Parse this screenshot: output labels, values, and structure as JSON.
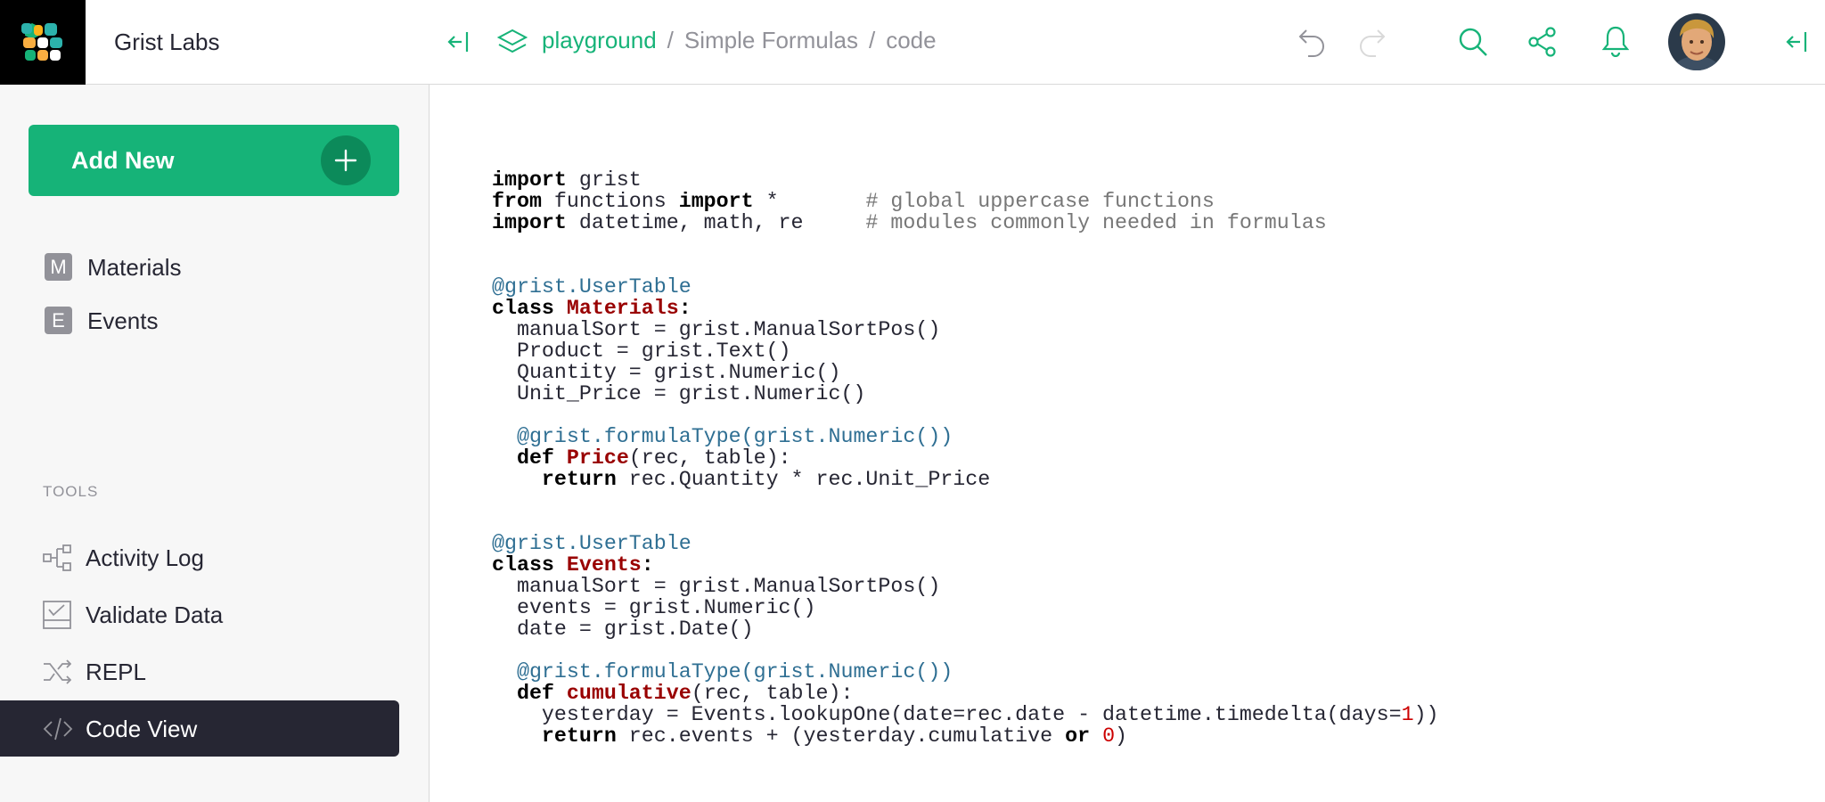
{
  "org": {
    "name": "Grist Labs"
  },
  "left_panel": {
    "add_new_label": "Add New",
    "pages": [
      {
        "initial": "M",
        "label": "Materials"
      },
      {
        "initial": "E",
        "label": "Events"
      }
    ],
    "tools_header": "TOOLS",
    "tools": [
      {
        "label": "Activity Log",
        "icon": "activity-log-icon"
      },
      {
        "label": "Validate Data",
        "icon": "validate-data-icon"
      },
      {
        "label": "REPL",
        "icon": "repl-icon"
      },
      {
        "label": "Code View",
        "icon": "code-view-icon",
        "active": true
      }
    ]
  },
  "topbar": {
    "breadcrumb": {
      "workspace": "playground",
      "separator": "/",
      "document": "Simple Formulas",
      "page": "code"
    },
    "icons": [
      "collapse-panel-icon",
      "workspace-icon",
      "undo-icon",
      "redo-icon",
      "search-icon",
      "share-icon",
      "notifications-icon",
      "avatar",
      "collapse-right-panel-icon"
    ]
  },
  "colors": {
    "accent": "#16b378",
    "active_tool_bg": "#262633",
    "logo_bg": "#000000"
  },
  "code_lines": [
    [
      {
        "t": "import",
        "c": "kw"
      },
      {
        "t": " grist",
        "c": ""
      }
    ],
    [
      {
        "t": "from",
        "c": "kw"
      },
      {
        "t": " functions ",
        "c": ""
      },
      {
        "t": "import",
        "c": "kw"
      },
      {
        "t": " *       ",
        "c": ""
      },
      {
        "t": "# global uppercase functions",
        "c": "cm"
      }
    ],
    [
      {
        "t": "import",
        "c": "kw"
      },
      {
        "t": " datetime, math, re     ",
        "c": ""
      },
      {
        "t": "# modules commonly needed in formulas",
        "c": "cm"
      }
    ],
    [],
    [],
    [
      {
        "t": "@grist.UserTable",
        "c": "dec"
      }
    ],
    [
      {
        "t": "class",
        "c": "kw"
      },
      {
        "t": " ",
        "c": ""
      },
      {
        "t": "Materials",
        "c": "nm"
      },
      {
        "t": ":",
        "c": "kw"
      }
    ],
    [
      {
        "t": "  manualSort = grist.ManualSortPos()",
        "c": ""
      }
    ],
    [
      {
        "t": "  Product = grist.Text()",
        "c": ""
      }
    ],
    [
      {
        "t": "  Quantity = grist.Numeric()",
        "c": ""
      }
    ],
    [
      {
        "t": "  Unit_Price = grist.Numeric()",
        "c": ""
      }
    ],
    [],
    [
      {
        "t": "  ",
        "c": ""
      },
      {
        "t": "@grist.formulaType(grist.Numeric())",
        "c": "dec"
      }
    ],
    [
      {
        "t": "  ",
        "c": ""
      },
      {
        "t": "def",
        "c": "kw"
      },
      {
        "t": " ",
        "c": ""
      },
      {
        "t": "Price",
        "c": "nm"
      },
      {
        "t": "(rec, table):",
        "c": ""
      }
    ],
    [
      {
        "t": "    ",
        "c": ""
      },
      {
        "t": "return",
        "c": "kw"
      },
      {
        "t": " rec.Quantity * rec.Unit_Price",
        "c": ""
      }
    ],
    [],
    [],
    [
      {
        "t": "@grist.UserTable",
        "c": "dec"
      }
    ],
    [
      {
        "t": "class",
        "c": "kw"
      },
      {
        "t": " ",
        "c": ""
      },
      {
        "t": "Events",
        "c": "nm"
      },
      {
        "t": ":",
        "c": "kw"
      }
    ],
    [
      {
        "t": "  manualSort = grist.ManualSortPos()",
        "c": ""
      }
    ],
    [
      {
        "t": "  events = grist.Numeric()",
        "c": ""
      }
    ],
    [
      {
        "t": "  date = grist.Date()",
        "c": ""
      }
    ],
    [],
    [
      {
        "t": "  ",
        "c": ""
      },
      {
        "t": "@grist.formulaType(grist.Numeric())",
        "c": "dec"
      }
    ],
    [
      {
        "t": "  ",
        "c": ""
      },
      {
        "t": "def",
        "c": "kw"
      },
      {
        "t": " ",
        "c": ""
      },
      {
        "t": "cumulative",
        "c": "nm"
      },
      {
        "t": "(rec, table):",
        "c": ""
      }
    ],
    [
      {
        "t": "    yesterday = Events.lookupOne(date=rec.date - datetime.timedelta(days=",
        "c": ""
      },
      {
        "t": "1",
        "c": "num"
      },
      {
        "t": "))",
        "c": ""
      }
    ],
    [
      {
        "t": "    ",
        "c": ""
      },
      {
        "t": "return",
        "c": "kw"
      },
      {
        "t": " rec.events + (yesterday.cumulative ",
        "c": ""
      },
      {
        "t": "or",
        "c": "kw"
      },
      {
        "t": " ",
        "c": ""
      },
      {
        "t": "0",
        "c": "num"
      },
      {
        "t": ")",
        "c": ""
      }
    ]
  ]
}
